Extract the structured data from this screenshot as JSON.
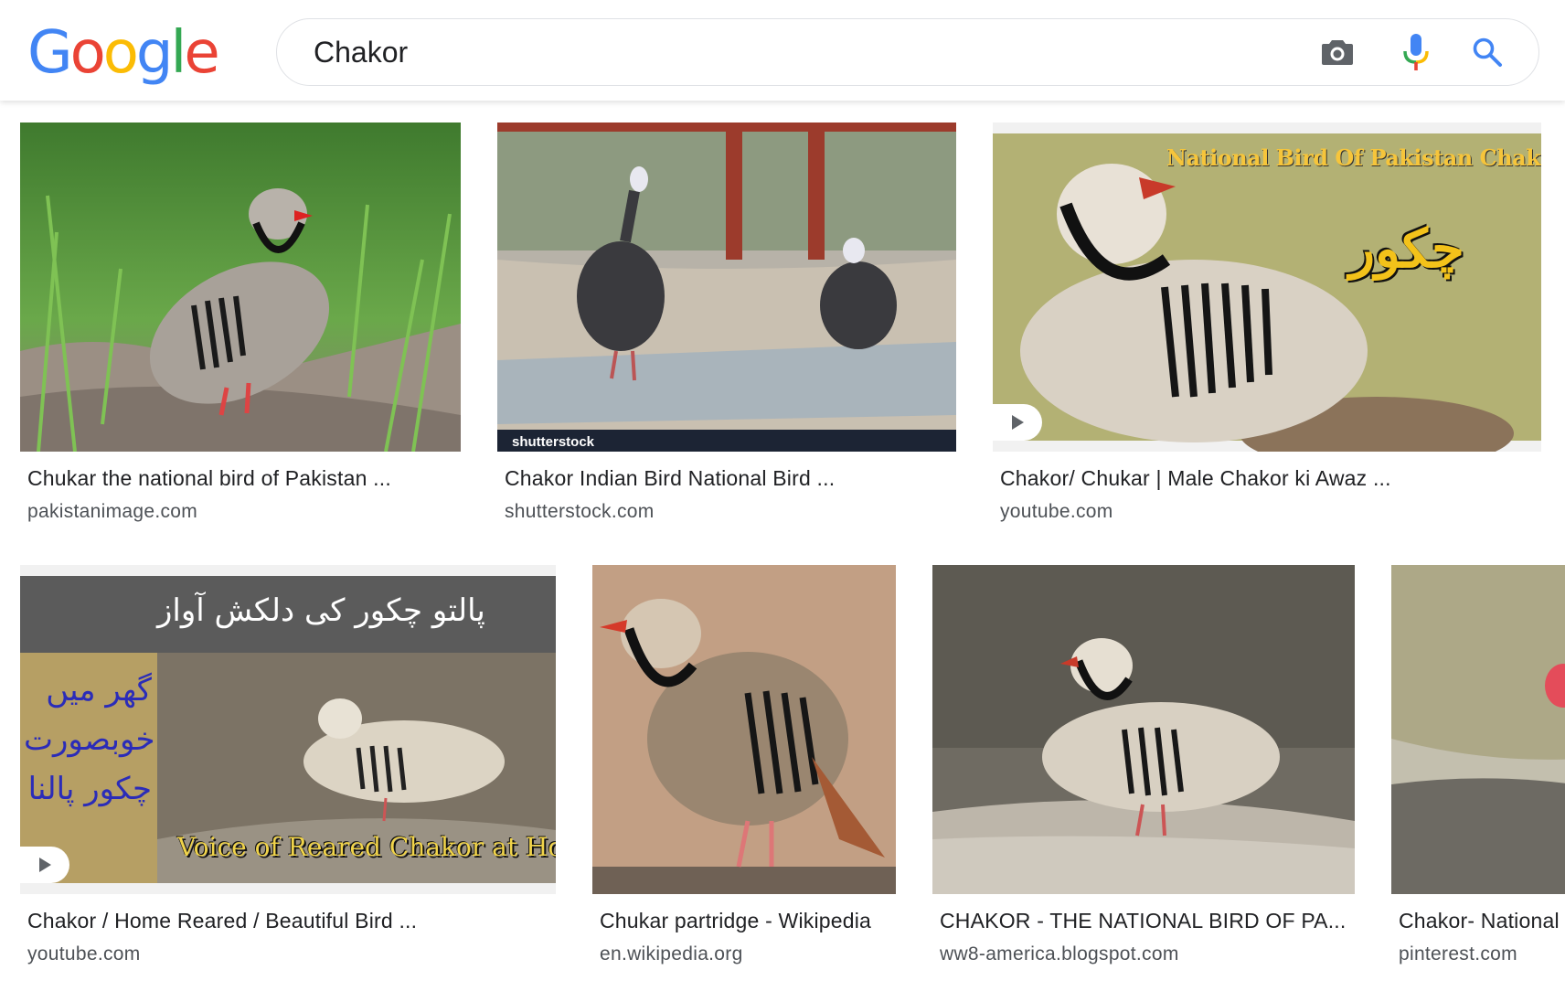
{
  "header": {
    "logo_letters": [
      "G",
      "o",
      "o",
      "g",
      "l",
      "e"
    ],
    "logo_colors": [
      "#4285F4",
      "#EA4335",
      "#FBBC05",
      "#4285F4",
      "#34A853",
      "#EA4335"
    ],
    "search": {
      "value": "Chakor",
      "placeholder": ""
    },
    "icons": {
      "camera": "camera-icon",
      "mic": "microphone-icon",
      "search": "search-icon"
    }
  },
  "results": [
    {
      "caption": "Chukar the national bird of Pakistan ...",
      "source": "pakistanimage.com",
      "is_video": false
    },
    {
      "caption": "Chakor Indian Bird National Bird ...",
      "source": "shutterstock.com",
      "is_video": false,
      "watermark": "shutterstock"
    },
    {
      "caption": "Chakor/ Chukar | Male Chakor ki Awaz ...",
      "source": "youtube.com",
      "is_video": true,
      "overlay_title": "National Bird Of Pakistan Chakor",
      "overlay_urdu": "چکور"
    },
    {
      "caption": "Chakor / Home Reared / Beautiful Bird ...",
      "source": "youtube.com",
      "is_video": true,
      "overlay_urdu_top": "پالتو چکور کی    دلکش آواز",
      "overlay_urdu_side": "گھر میں خوبصورت چکور پالنا",
      "overlay_caption": "Voice of Reared Chakor at Home"
    },
    {
      "caption": "Chukar partridge - Wikipedia",
      "source": "en.wikipedia.org",
      "is_video": false
    },
    {
      "caption": "CHAKOR - THE NATIONAL BIRD OF PA...",
      "source": "ww8-america.blogspot.com",
      "is_video": false
    },
    {
      "caption": "Chakor- National",
      "source": "pinterest.com",
      "is_video": false
    }
  ],
  "colors": {
    "google_blue": "#4285F4",
    "google_red": "#EA4335",
    "google_yellow": "#FBBC05",
    "google_green": "#34A853",
    "source_text": "#4d5156"
  }
}
